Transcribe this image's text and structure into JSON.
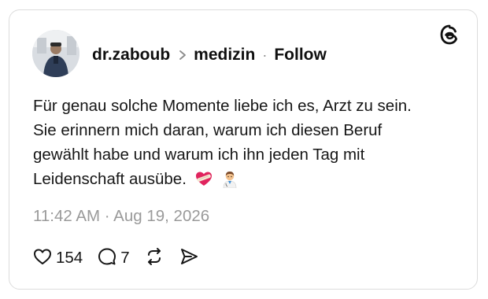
{
  "post": {
    "author": {
      "username": "dr.zaboub",
      "avatar": "avatar-photo"
    },
    "topic": "medizin",
    "separator": "·",
    "follow_label": "Follow",
    "logo_icon": "threads-logo-icon",
    "body_text": "Für genau solche Momente liebe ich es, Arzt zu sein. Sie erinnern mich daran, warum ich diesen Beruf gewählt habe und warum ich ihn jeden Tag mit Leidenschaft ausübe.",
    "body_emojis": [
      "heart-with-bandage",
      "man-health-worker"
    ],
    "timestamp": "11:42 AM · Aug 19, 2026",
    "actions": {
      "like": {
        "icon": "heart-icon",
        "count": "154"
      },
      "reply": {
        "icon": "comment-icon",
        "count": "7"
      },
      "repost": {
        "icon": "repost-icon"
      },
      "share": {
        "icon": "share-icon"
      }
    }
  },
  "colors": {
    "text": "#101010",
    "muted": "#9a9a9a",
    "border": "#dcdcdc",
    "heart": "#e0245e"
  }
}
